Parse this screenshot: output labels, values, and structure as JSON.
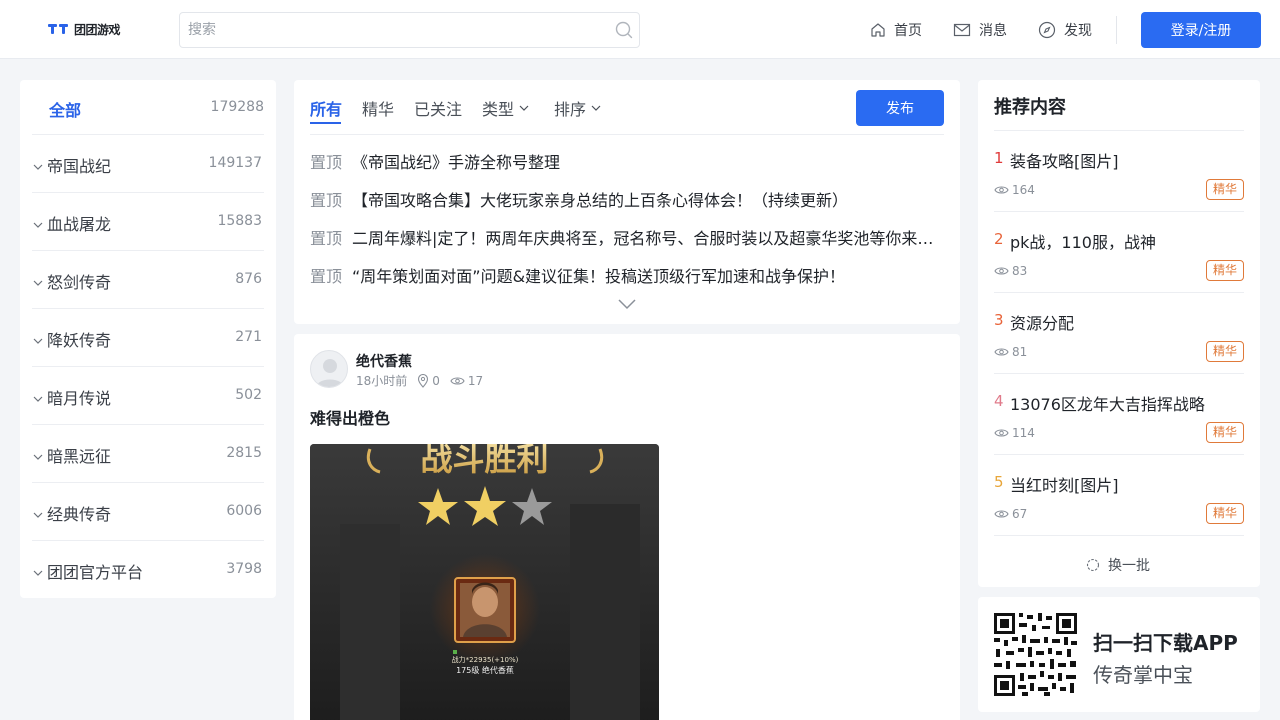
{
  "header": {
    "logo_text": "团团游戏",
    "search_placeholder": "搜索",
    "nav": [
      {
        "label": "首页",
        "icon": "home-icon"
      },
      {
        "label": "消息",
        "icon": "mail-icon"
      },
      {
        "label": "发现",
        "icon": "compass-icon"
      }
    ],
    "login_label": "登录/注册"
  },
  "sidebar": {
    "all": {
      "label": "全部",
      "count": "179288"
    },
    "items": [
      {
        "label": "帝国战纪",
        "count": "149137"
      },
      {
        "label": "血战屠龙",
        "count": "15883"
      },
      {
        "label": "怒剑传奇",
        "count": "876"
      },
      {
        "label": "降妖传奇",
        "count": "271"
      },
      {
        "label": "暗月传说",
        "count": "502"
      },
      {
        "label": "暗黑远征",
        "count": "2815"
      },
      {
        "label": "经典传奇",
        "count": "6006"
      },
      {
        "label": "团团官方平台",
        "count": "3798"
      }
    ]
  },
  "main": {
    "tabs": [
      {
        "label": "所有",
        "active": true
      },
      {
        "label": "精华"
      },
      {
        "label": "已关注"
      },
      {
        "label": "类型",
        "dropdown": true
      },
      {
        "label": "排序",
        "dropdown": true
      }
    ],
    "publish_label": "发布",
    "pinned": [
      {
        "tag": "置顶",
        "title": "《帝国战纪》手游全称号整理"
      },
      {
        "tag": "置顶",
        "title": "【帝国攻略合集】大佬玩家亲身总结的上百条心得体会！（持续更新）"
      },
      {
        "tag": "置顶",
        "title": "二周年爆料|定了！两周年庆典将至，冠名称号、合服时装以及超豪华奖池等你来…"
      },
      {
        "tag": "置顶",
        "title": "“周年策划面对面”问题&建议征集！投稿送顶级行军加速和战争保护！"
      }
    ],
    "post": {
      "author": "绝代香蕉",
      "time": "18小时前",
      "location_count": "0",
      "views": "17",
      "title": "难得出橙色",
      "image_text": {
        "banner": "战斗胜利",
        "power": "战力*22935(+10%)",
        "name": "175级 绝代香蕉"
      }
    }
  },
  "recommend": {
    "title": "推荐内容",
    "items": [
      {
        "rank": "1",
        "rank_color": "#e03a3a",
        "title": "装备攻略[图片]",
        "views": "164",
        "badge": "精华"
      },
      {
        "rank": "2",
        "rank_color": "#e8643a",
        "title": "pk战，110服，战神",
        "views": "83",
        "badge": "精华"
      },
      {
        "rank": "3",
        "rank_color": "#e8643a",
        "title": "资源分配",
        "views": "81",
        "badge": "精华"
      },
      {
        "rank": "4",
        "rank_color": "#e07a8a",
        "title": "13076区龙年大吉指挥战略",
        "views": "114",
        "badge": "精华"
      },
      {
        "rank": "5",
        "rank_color": "#e8a63a",
        "title": "当红时刻[图片]",
        "views": "67",
        "badge": "精华"
      }
    ],
    "refresh_label": "换一批"
  },
  "app": {
    "title": "扫一扫下载APP",
    "subtitle": "传奇掌中宝"
  }
}
